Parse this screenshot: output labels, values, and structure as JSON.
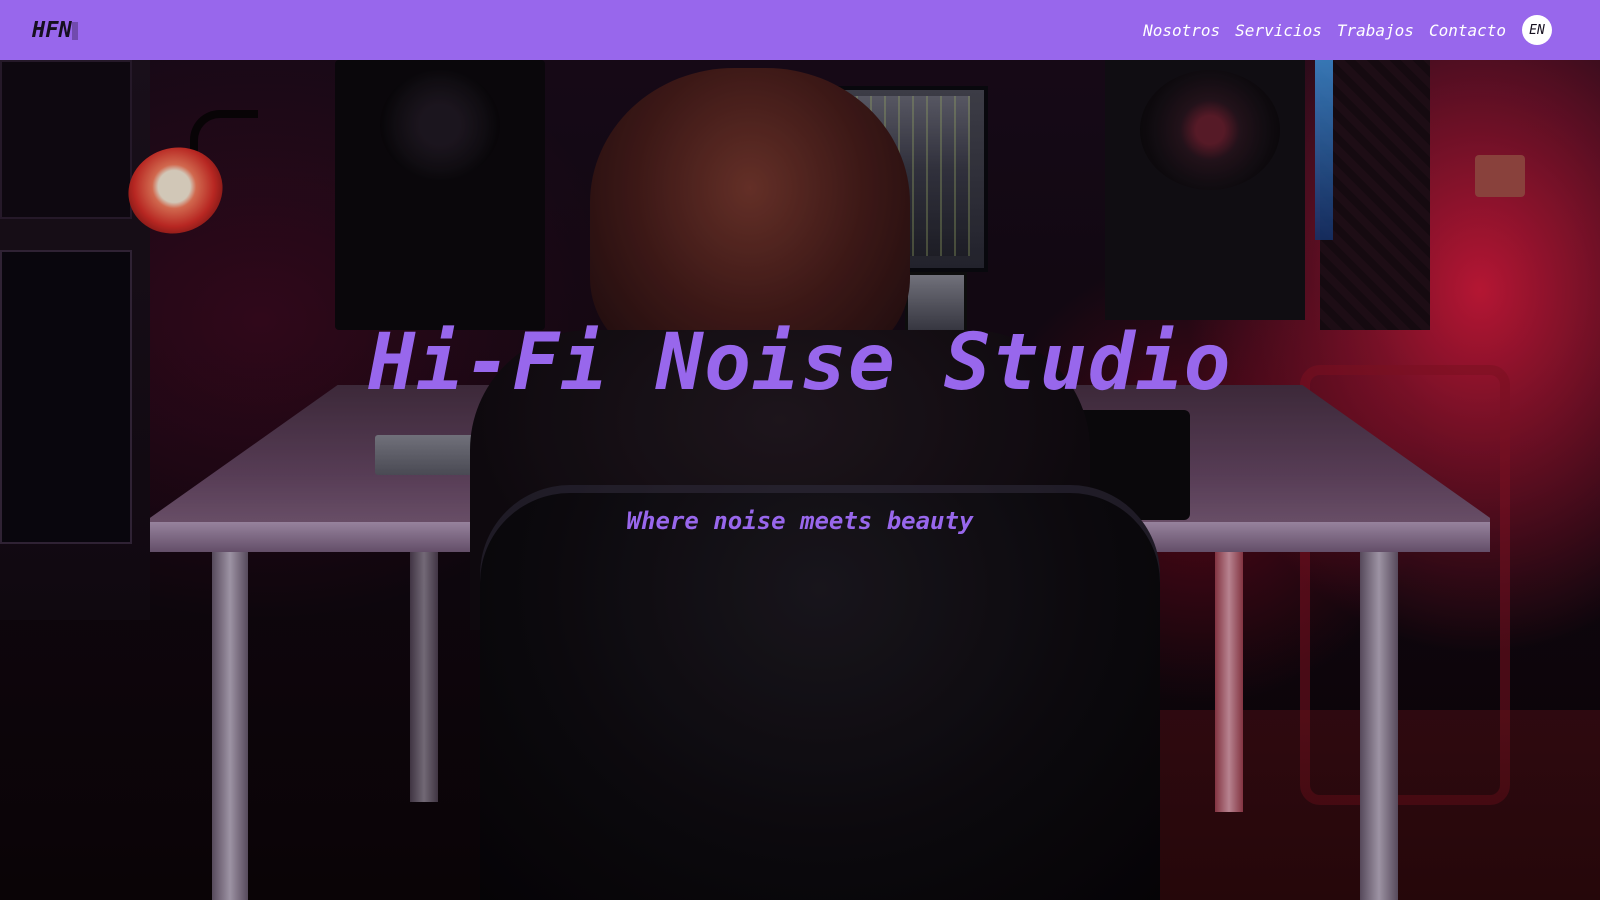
{
  "header": {
    "logo": "HFN",
    "nav_links": [
      "Nosotros",
      "Servicios",
      "Trabajos",
      "Contacto"
    ],
    "language_button": "EN"
  },
  "hero": {
    "title": "Hi-Fi Noise Studio",
    "subtitle": "Where noise meets beauty",
    "background_image": "recording-studio-photo"
  },
  "colors": {
    "brand_purple": "#9867ec",
    "nav_text": "#ffffff",
    "logo_text": "#16101f"
  }
}
